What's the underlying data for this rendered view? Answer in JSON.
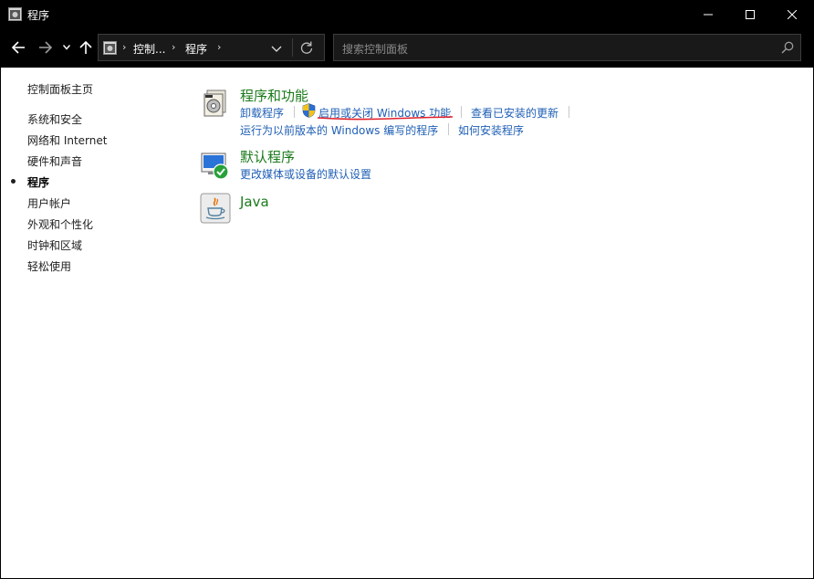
{
  "window": {
    "title": "程序",
    "controls": [
      "minimize-icon",
      "maximize-icon",
      "close-icon"
    ]
  },
  "navigation": {
    "buttons": [
      "back-arrow-icon",
      "forward-arrow-icon",
      "recent-locations-icon",
      "up-arrow-icon"
    ],
    "breadcrumb": [
      "控制...",
      "程序"
    ],
    "search_placeholder": "搜索控制面板"
  },
  "sidebar": {
    "home": "控制面板主页",
    "items": [
      {
        "label": "系统和安全",
        "active": false
      },
      {
        "label": "网络和 Internet",
        "active": false
      },
      {
        "label": "硬件和声音",
        "active": false
      },
      {
        "label": "程序",
        "active": true
      },
      {
        "label": "用户帐户",
        "active": false
      },
      {
        "label": "外观和个性化",
        "active": false
      },
      {
        "label": "时钟和区域",
        "active": false
      },
      {
        "label": "轻松使用",
        "active": false
      }
    ]
  },
  "categories": [
    {
      "title": "程序和功能",
      "icon": "programs-features-icon",
      "links": [
        "卸载程序",
        "启用或关闭 Windows 功能",
        "查看已安装的更新",
        "运行为以前版本的 Windows 编写的程序",
        "如何安装程序"
      ]
    },
    {
      "title": "默认程序",
      "icon": "default-programs-icon",
      "links": [
        "更改媒体或设备的默认设置"
      ]
    },
    {
      "title": "Java",
      "icon": "java-icon",
      "links": []
    }
  ],
  "colors": {
    "title_bar": "#000000",
    "category_title": "#1a7a1a",
    "link": "#1f5fb5",
    "annotation_underline": "#e0202a"
  }
}
